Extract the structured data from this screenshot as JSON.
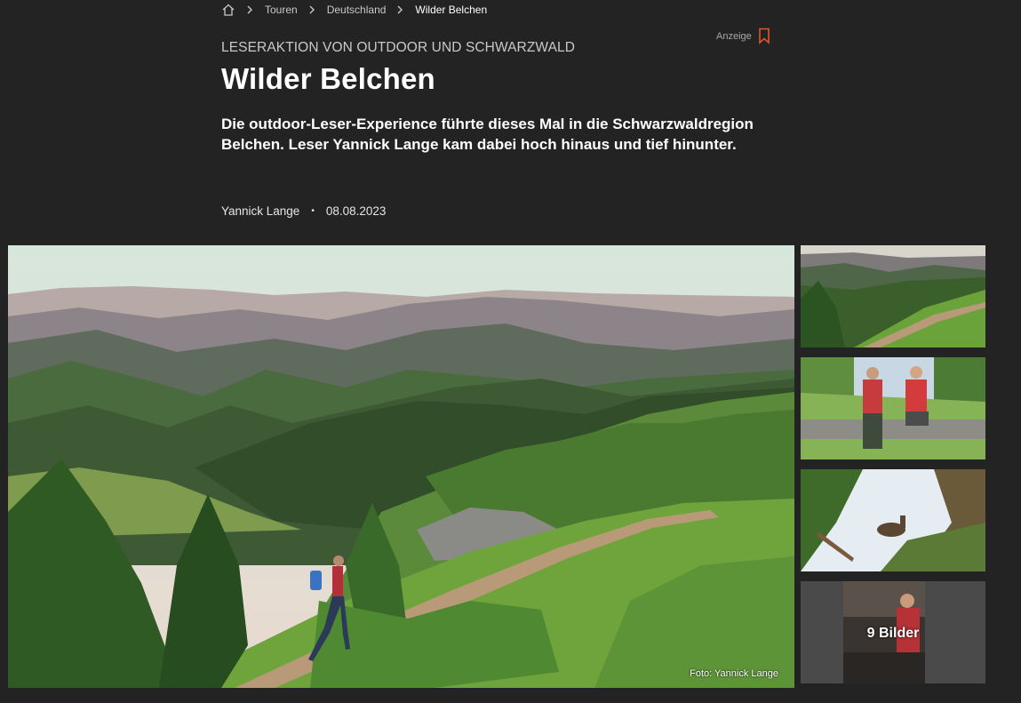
{
  "breadcrumb": {
    "home_icon": "home-icon",
    "items": [
      "Touren",
      "Deutschland"
    ],
    "current": "Wilder Belchen"
  },
  "ad": {
    "label": "Anzeige",
    "icon": "bookmark-icon",
    "accent": "#e2532d"
  },
  "article": {
    "kicker": "LESERAKTION VON OUTDOOR UND SCHWARZWALD",
    "title": "Wilder Belchen",
    "lead": "Die outdoor-Leser-Experience führte dieses Mal in die Schwarzwaldregion Belchen. Leser Yannick Lange kam dabei hoch hinaus und tief hinunter.",
    "author": "Yannick Lange",
    "date": "08.08.2023"
  },
  "gallery": {
    "credit": "Foto: Yannick Lange",
    "more_label": "9 Bilder"
  }
}
